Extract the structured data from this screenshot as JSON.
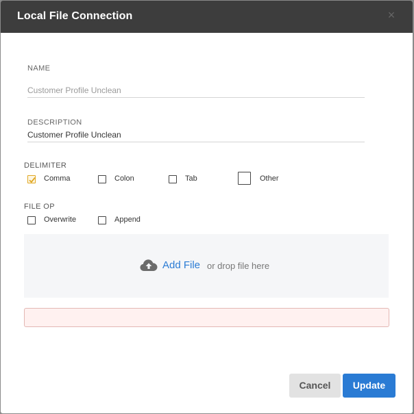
{
  "dialog": {
    "title": "Local File Connection",
    "close_symbol": "×"
  },
  "name_field": {
    "label": "NAME",
    "value": "",
    "placeholder": "Customer Profile Unclean"
  },
  "description_field": {
    "label": "DESCRIPTION",
    "value": "Customer Profile Unclean"
  },
  "delimiter": {
    "label": "DELIMITER",
    "options": [
      {
        "label": "Comma",
        "checked": true
      },
      {
        "label": "Colon",
        "checked": false
      },
      {
        "label": "Tab",
        "checked": false
      },
      {
        "label": "Other",
        "checked": false
      }
    ]
  },
  "file_op": {
    "label": "FILE OP",
    "options": [
      {
        "label": "Overwrite",
        "checked": false
      },
      {
        "label": "Append",
        "checked": false
      }
    ]
  },
  "upload": {
    "icon": "cloud-upload-icon",
    "add_file_label": "Add File",
    "drop_text": "or drop file here"
  },
  "buttons": {
    "cancel": "Cancel",
    "update": "Update"
  },
  "colors": {
    "header_bg": "#3d3d3d",
    "accent_blue": "#2a7bd4",
    "check_orange": "#e0a722"
  }
}
